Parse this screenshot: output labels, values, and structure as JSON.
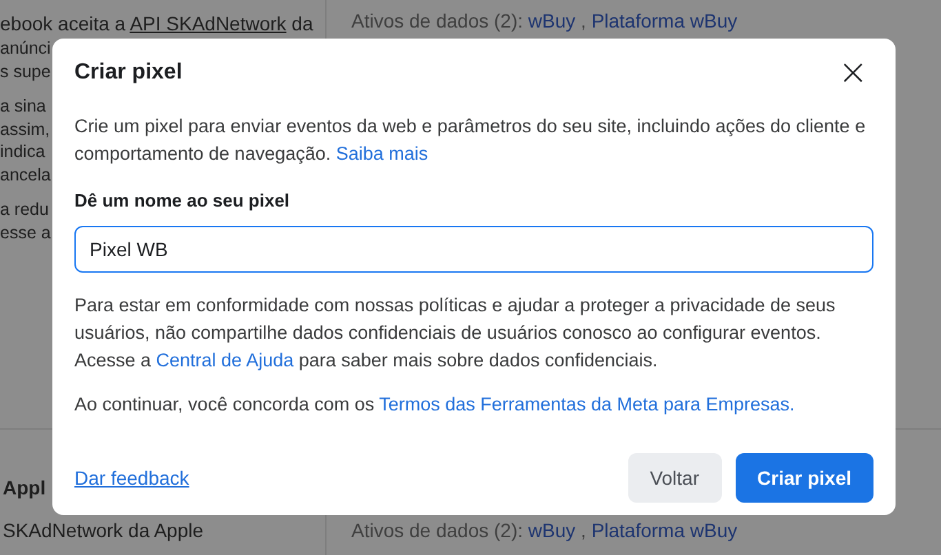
{
  "background": {
    "top_line": {
      "before": "ebook aceita a ",
      "link": "API SKAdNetwork",
      "after": " da"
    },
    "left_fragments": [
      "anúnci",
      "s supe",
      "a sina",
      "assim,",
      "indica",
      "ancela",
      "a redu",
      "esse a"
    ],
    "section_title": "Appl",
    "section_subtitle": "SKAdNetwork da Apple",
    "asset_rows": [
      {
        "label": "Ativos de dados (2):",
        "assets": [
          "wBuy",
          "Plataforma wBuy"
        ],
        "separator": ","
      },
      {
        "label": "Ativos de dados (2):",
        "assets": [
          "wBuy",
          "Plataforma wBuy"
        ],
        "separator": ","
      }
    ]
  },
  "dialog": {
    "title": "Criar pixel",
    "close": "×",
    "description": {
      "before": "Crie um pixel para enviar eventos da web e parâmetros do seu site, incluindo ações do cliente e comportamento de navegação. ",
      "link": "Saiba mais"
    },
    "field_label": "Dê um nome ao seu pixel",
    "field_value": "Pixel WB",
    "privacy_note": {
      "before": "Para estar em conformidade com nossas políticas e ajudar a proteger a privacidade de seus usuários, não compartilhe dados confidenciais de usuários conosco ao configurar eventos. Acesse a ",
      "link": "Central de Ajuda",
      "after": " para saber mais sobre dados confidenciais."
    },
    "terms_note": {
      "before": "Ao continuar, você concorda com os ",
      "link": "Termos das Ferramentas da Meta para Empresas."
    },
    "feedback_link": "Dar feedback",
    "buttons": [
      {
        "label": "Voltar",
        "kind": "secondary"
      },
      {
        "label": "Criar pixel",
        "kind": "primary"
      }
    ]
  }
}
